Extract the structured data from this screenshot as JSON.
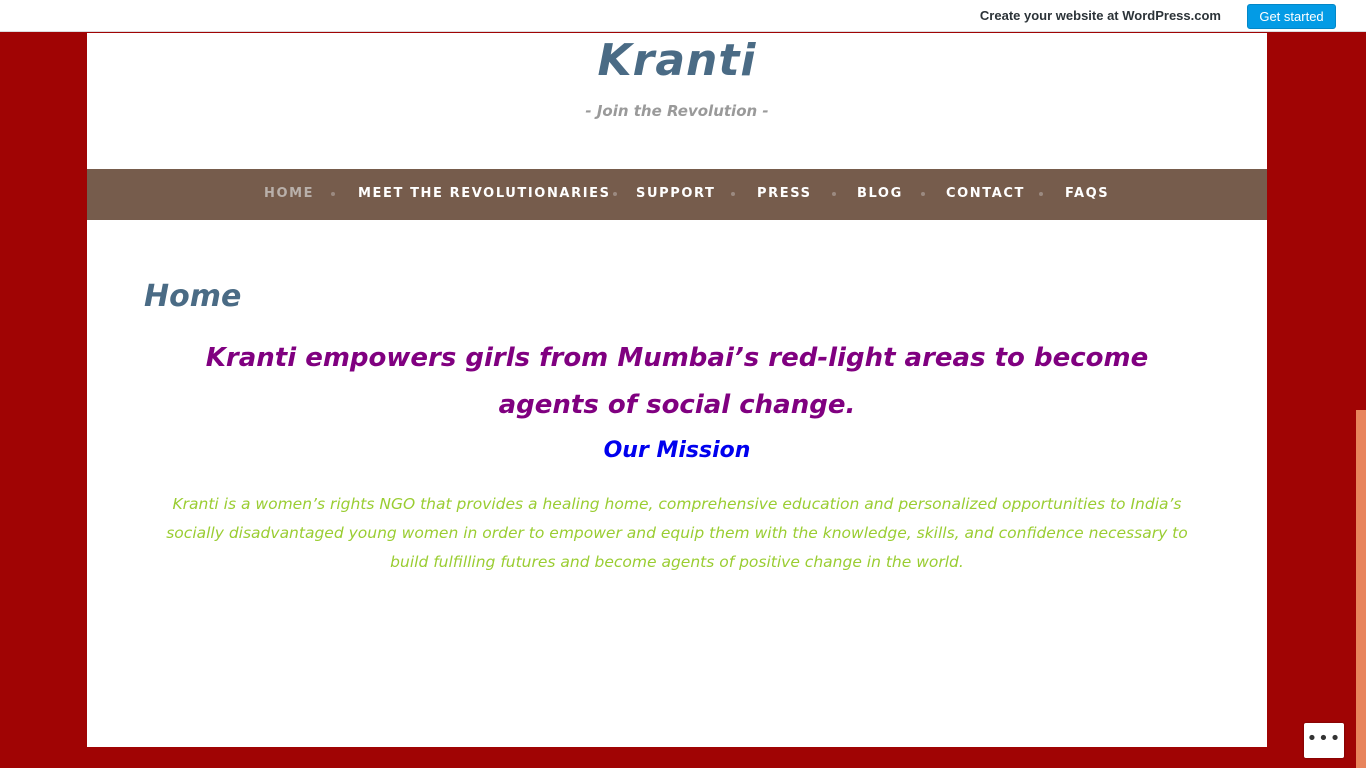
{
  "wp_bar": {
    "create_text": "Create your website at WordPress.com",
    "get_started": "Get started"
  },
  "site": {
    "title": "Kranti",
    "tagline": "- Join the Revolution -"
  },
  "nav": {
    "items": [
      {
        "label": "HOME",
        "active": true
      },
      {
        "label": "MEET THE REVOLUTIONARIES",
        "active": false
      },
      {
        "label": "SUPPORT",
        "active": false
      },
      {
        "label": "PRESS",
        "active": false
      },
      {
        "label": "BLOG",
        "active": false
      },
      {
        "label": "CONTACT",
        "active": false
      },
      {
        "label": "FAQS",
        "active": false
      }
    ]
  },
  "main": {
    "heading": "Home",
    "lead": "Kranti empowers girls from Mumbai’s red-light areas to become agents of social change.",
    "mission_heading": "Our Mission",
    "mission_text": "Kranti is a women’s rights NGO that provides a healing home, comprehensive education and personalized opportunities to India’s socially disadvantaged young women in order to empower and equip them with the knowledge, skills, and confidence necessary to build fulfilling futures and become agents of positive change in the world."
  },
  "actions": {
    "more_icon": "more-horizontal-icon"
  },
  "colors": {
    "background": "#a00404",
    "nav_bar": "#765c4c",
    "title": "#4a6b85",
    "lead": "#800080",
    "mission_heading": "#0000ee",
    "mission_text": "#9acd32",
    "wp_button": "#039be5"
  }
}
